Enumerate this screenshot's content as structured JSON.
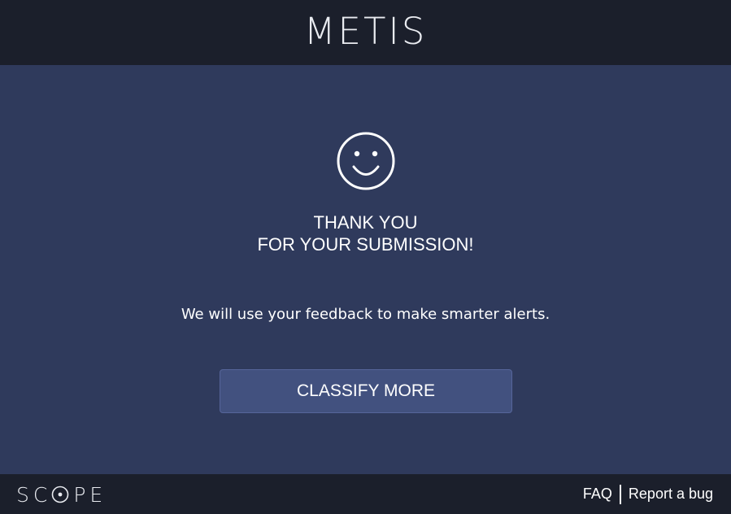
{
  "header": {
    "brand": "METIS"
  },
  "main": {
    "icon": "smiley-face-icon",
    "thanks_line1": "THANK YOU",
    "thanks_line2": "FOR YOUR SUBMISSION!",
    "message": "We will use your feedback to make smarter alerts.",
    "classify_button_label": "CLASSIFY MORE"
  },
  "footer": {
    "logo_text_before": "SC",
    "logo_text_after": "PE",
    "faq_label": "FAQ",
    "report_bug_label": "Report a bug"
  },
  "colors": {
    "header_bg": "#1b1f2b",
    "main_bg": "#2f3a5c",
    "button_bg": "#42517f",
    "text": "#ffffff"
  }
}
